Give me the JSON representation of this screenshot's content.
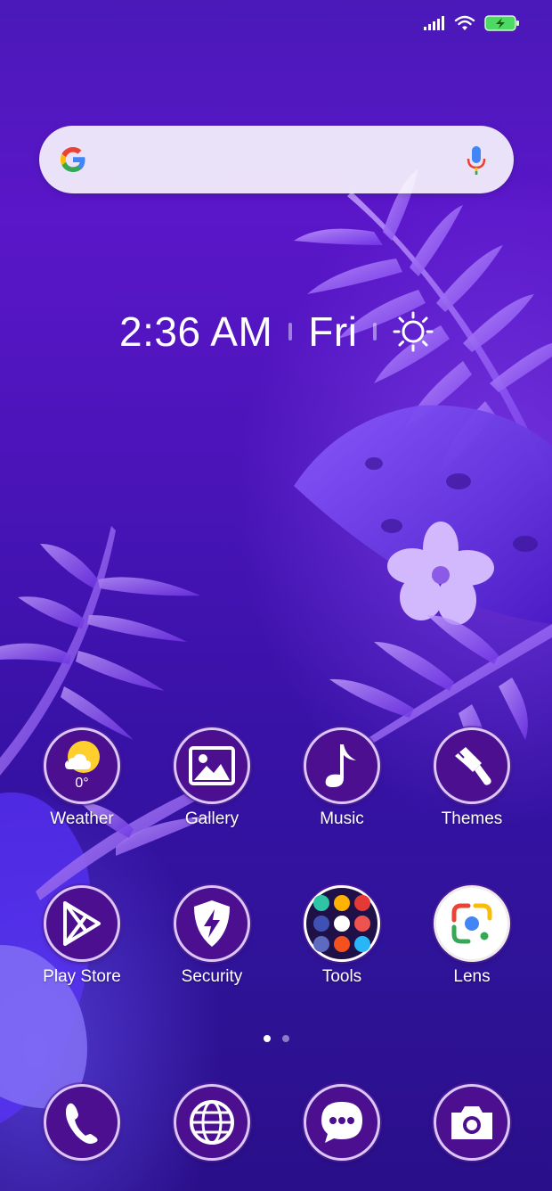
{
  "status_bar": {
    "icons": [
      "signal-icon",
      "wifi-icon",
      "battery-charging-icon"
    ],
    "battery_color": "#4cd964"
  },
  "search_bar": {
    "logo": "google-g-icon",
    "mic": "microphone-icon"
  },
  "clock": {
    "time": "2:36 AM",
    "day": "Fri",
    "weather_icon": "sun-icon"
  },
  "apps_row1": [
    {
      "label": "Weather",
      "icon": "weather-icon",
      "temp": "0°"
    },
    {
      "label": "Gallery",
      "icon": "gallery-icon"
    },
    {
      "label": "Music",
      "icon": "music-note-icon"
    },
    {
      "label": "Themes",
      "icon": "paintbrush-icon"
    }
  ],
  "apps_row2": [
    {
      "label": "Play Store",
      "icon": "play-store-icon"
    },
    {
      "label": "Security",
      "icon": "shield-bolt-icon"
    },
    {
      "label": "Tools",
      "icon": "tools-folder-icon"
    },
    {
      "label": "Lens",
      "icon": "google-lens-icon"
    }
  ],
  "page_indicator": {
    "pages": 2,
    "active": 1
  },
  "dock": [
    {
      "name": "phone",
      "icon": "phone-icon"
    },
    {
      "name": "browser",
      "icon": "globe-icon"
    },
    {
      "name": "messages",
      "icon": "chat-bubble-icon"
    },
    {
      "name": "camera",
      "icon": "camera-icon"
    }
  ],
  "colors": {
    "background_top": "#4a19b8",
    "background_bottom": "#2a0f8a",
    "icon_fill": "#4b0f8f",
    "icon_ring": "#d9c8f7"
  }
}
